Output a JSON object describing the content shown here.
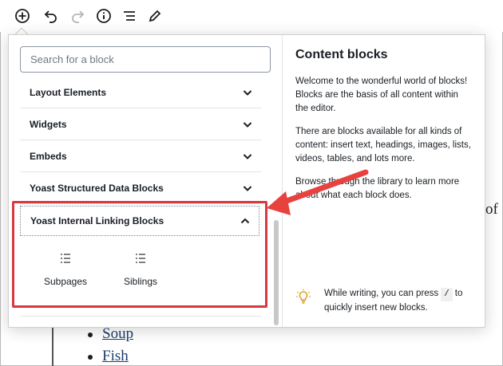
{
  "toolbar": {
    "buttons": [
      {
        "name": "add-block",
        "icon": "plus-circle-icon"
      },
      {
        "name": "undo",
        "icon": "undo-icon"
      },
      {
        "name": "redo",
        "icon": "redo-icon"
      },
      {
        "name": "info",
        "icon": "info-icon"
      },
      {
        "name": "outline",
        "icon": "list-outline-icon"
      },
      {
        "name": "tools",
        "icon": "pencil-icon"
      }
    ]
  },
  "inserter": {
    "search": {
      "placeholder": "Search for a block",
      "value": ""
    },
    "categories": [
      {
        "label": "Layout Elements",
        "expanded": false
      },
      {
        "label": "Widgets",
        "expanded": false
      },
      {
        "label": "Embeds",
        "expanded": false
      },
      {
        "label": "Yoast Structured Data Blocks",
        "expanded": false
      },
      {
        "label": "Yoast Internal Linking Blocks",
        "expanded": true
      }
    ],
    "blocks": [
      {
        "label": "Subpages",
        "icon": "list-icon"
      },
      {
        "label": "Siblings",
        "icon": "list-icon"
      }
    ],
    "info_panel": {
      "title": "Content blocks",
      "paragraphs": [
        "Welcome to the wonderful world of blocks! Blocks are the basis of all content within the editor.",
        "There are blocks available for all kinds of content: insert text, headings, images, lists, videos, tables, and lots more.",
        "Browse through the library to learn more about what each block does."
      ],
      "tip": {
        "icon": "lightbulb-icon",
        "text_before": "While writing, you can press",
        "key": "/",
        "text_after": "to quickly insert new blocks."
      }
    }
  },
  "background": {
    "fragment": "of",
    "list_items": [
      "Soup",
      "Fish"
    ]
  },
  "colors": {
    "highlight": "#d8383f",
    "arrow": "#e8423f",
    "link": "#1a3d6d"
  }
}
